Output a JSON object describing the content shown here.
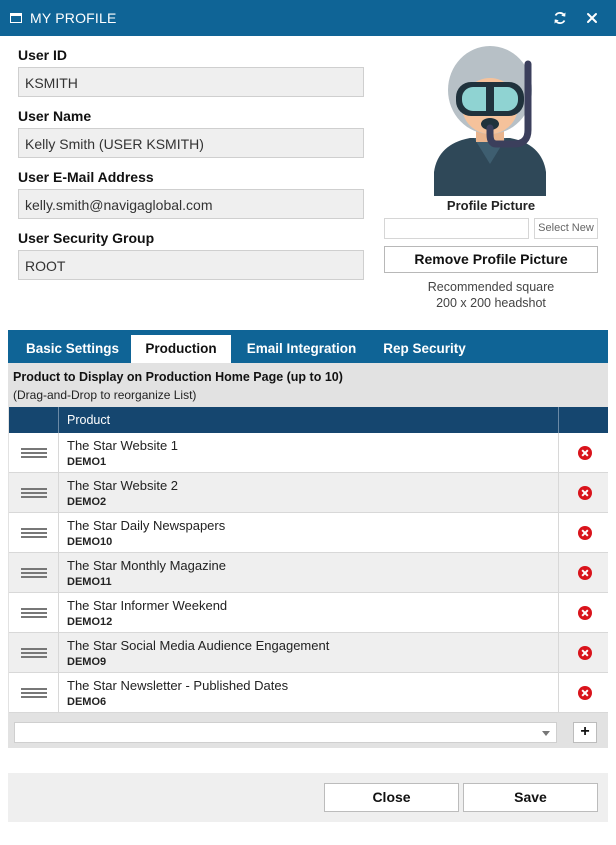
{
  "window": {
    "title": "MY PROFILE",
    "refresh_icon": "refresh-icon",
    "close_icon": "close-icon",
    "accent_color": "#0f6496"
  },
  "fields": [
    {
      "label": "User ID",
      "value": "KSMITH"
    },
    {
      "label": "User Name",
      "value": "Kelly Smith (USER KSMITH)"
    },
    {
      "label": "User E-Mail Address",
      "value": "kelly.smith@navigaglobal.com"
    },
    {
      "label": "User Security Group",
      "value": "ROOT"
    }
  ],
  "profile_picture": {
    "label": "Profile Picture",
    "file_value": "",
    "select_button": "Select New",
    "remove_button": "Remove Profile Picture",
    "recommendation_line1": "Recommended square",
    "recommendation_line2": "200 x 200 headshot",
    "avatar_icon": "scuba-diver-avatar"
  },
  "tabs": [
    {
      "label": "Basic Settings",
      "active": false
    },
    {
      "label": "Production",
      "active": true
    },
    {
      "label": "Email Integration",
      "active": false
    },
    {
      "label": "Rep Security",
      "active": false
    }
  ],
  "production": {
    "heading": "Product to Display on Production Home Page (up to 10)",
    "subheading": "(Drag-and-Drop to reorganize List)",
    "column_header": "Product",
    "products": [
      {
        "name": "The Star Website 1",
        "code": "DEMO1"
      },
      {
        "name": "The Star Website 2",
        "code": "DEMO2"
      },
      {
        "name": "The Star Daily Newspapers",
        "code": "DEMO10"
      },
      {
        "name": "The Star Monthly Magazine",
        "code": "DEMO11"
      },
      {
        "name": "The Star Informer Weekend",
        "code": "DEMO12"
      },
      {
        "name": "The Star Social Media Audience Engagement",
        "code": "DEMO9"
      },
      {
        "name": "The Star Newsletter - Published Dates",
        "code": "DEMO6"
      }
    ],
    "add_select_value": "",
    "add_button": "+"
  },
  "footer": {
    "close_label": "Close",
    "save_label": "Save"
  }
}
